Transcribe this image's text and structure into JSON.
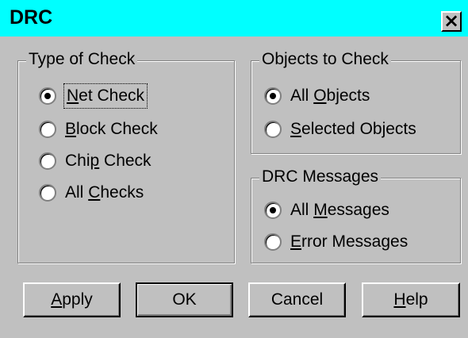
{
  "window": {
    "title": "DRC",
    "close_glyph": "×"
  },
  "type_of_check": {
    "title": "Type of Check",
    "options": [
      {
        "pre": "",
        "key": "N",
        "post": "et Check",
        "selected": true,
        "focused": true
      },
      {
        "pre": "",
        "key": "B",
        "post": "lock Check",
        "selected": false,
        "focused": false
      },
      {
        "pre": "Chi",
        "key": "p",
        "post": " Check",
        "selected": false,
        "focused": false
      },
      {
        "pre": "All ",
        "key": "C",
        "post": "hecks",
        "selected": false,
        "focused": false
      }
    ]
  },
  "objects_to_check": {
    "title": "Objects to Check",
    "options": [
      {
        "pre": "All ",
        "key": "O",
        "post": "bjects",
        "selected": true
      },
      {
        "pre": "",
        "key": "S",
        "post": "elected Objects",
        "selected": false
      }
    ]
  },
  "drc_messages": {
    "title": "DRC Messages",
    "options": [
      {
        "pre": "All ",
        "key": "M",
        "post": "essages",
        "selected": true
      },
      {
        "pre": "",
        "key": "E",
        "post": "rror Messages",
        "selected": false
      }
    ]
  },
  "buttons": {
    "apply": {
      "pre": "",
      "key": "A",
      "post": "pply"
    },
    "ok": {
      "label": "OK"
    },
    "cancel": {
      "label": "Cancel"
    },
    "help": {
      "pre": "",
      "key": "H",
      "post": "elp"
    }
  }
}
